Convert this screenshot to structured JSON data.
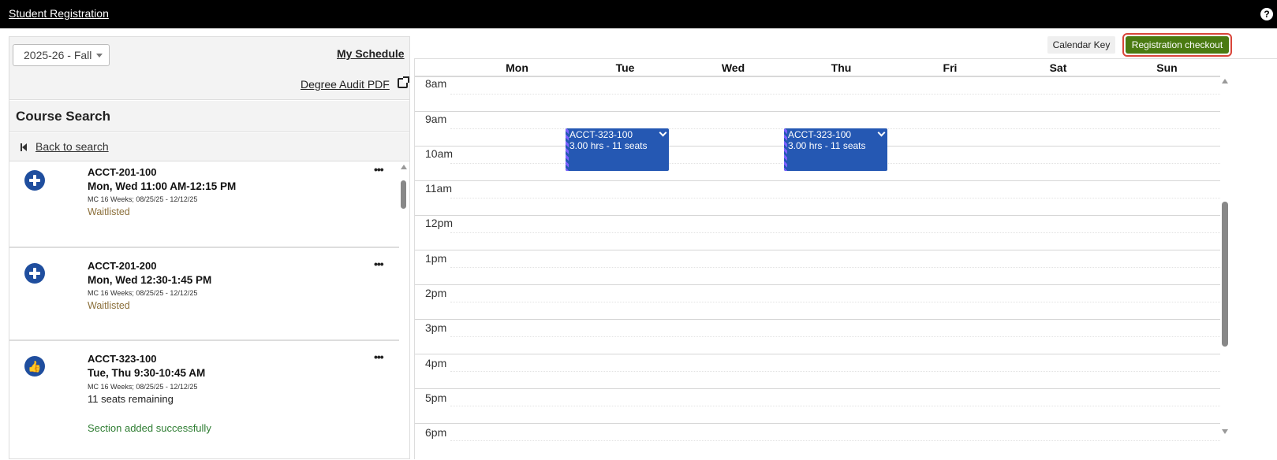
{
  "header": {
    "title": "Student Registration",
    "help_label": "?"
  },
  "left_panel": {
    "term": "2025-26 - Fall",
    "my_schedule": "My Schedule",
    "degree_audit": "Degree Audit PDF",
    "course_search_title": "Course Search",
    "back_to_search": "Back to search",
    "results": [
      {
        "icon": "plus-circle-icon",
        "code": "ACCT-201-100",
        "time": "Mon, Wed 11:00 AM-12:15 PM",
        "meta": "MC 16 Weeks; 08/25/25 - 12/12/25",
        "status": "Waitlisted",
        "more": "•••"
      },
      {
        "icon": "plus-circle-icon",
        "code": "ACCT-201-200",
        "time": "Mon, Wed 12:30-1:45 PM",
        "meta": "MC 16 Weeks; 08/25/25 - 12/12/25",
        "status": "Waitlisted",
        "more": "•••"
      },
      {
        "icon": "thumbs-up-icon",
        "code": "ACCT-323-100",
        "time": "Tue, Thu 9:30-10:45 AM",
        "meta": "MC 16 Weeks; 08/25/25 - 12/12/25",
        "seats": "11 seats remaining",
        "added": "Section added successfully",
        "more": "•••"
      }
    ]
  },
  "toolbar": {
    "calendar_key": "Calendar Key",
    "checkout": "Registration checkout"
  },
  "calendar": {
    "days": [
      "Mon",
      "Tue",
      "Wed",
      "Thu",
      "Fri",
      "Sat",
      "Sun"
    ],
    "hours": [
      "8am",
      "9am",
      "10am",
      "11am",
      "12pm",
      "1pm",
      "2pm",
      "3pm",
      "4pm",
      "5pm",
      "6pm"
    ],
    "events": [
      {
        "day": "Tue",
        "code": "ACCT-323-100",
        "detail": "3.00 hrs - 11 seats",
        "start": "9:30",
        "end": "10:45"
      },
      {
        "day": "Thu",
        "code": "ACCT-323-100",
        "detail": "3.00 hrs - 11 seats",
        "start": "9:30",
        "end": "10:45"
      }
    ]
  },
  "colors": {
    "accent": "#1f4e9e",
    "event": "#2558b3",
    "checkout": "#4a7a11",
    "highlight": "#d9453a",
    "waitlisted": "#8b6f3a",
    "success": "#2e7d32"
  }
}
